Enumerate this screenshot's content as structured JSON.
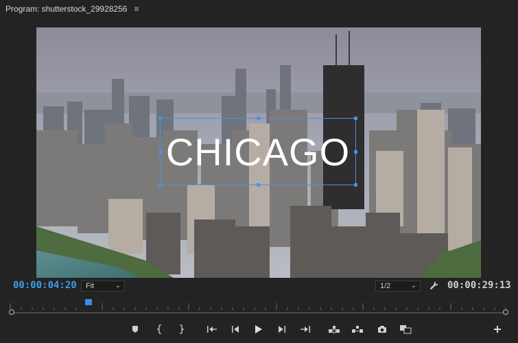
{
  "header": {
    "title": "Program: shutterstock_29928256",
    "menu_glyph": "≡"
  },
  "viewer": {
    "title_text": "CHICAGO"
  },
  "timecode": {
    "current": "00:00:04:20",
    "duration": "00:00:29:13"
  },
  "zoom_select": {
    "value": "Fit"
  },
  "resolution_select": {
    "value": "1/2"
  },
  "colors": {
    "accent": "#3b9cf0",
    "selection": "#4a90e2",
    "panel_bg": "#232323"
  },
  "transport": {
    "icons": [
      "add-marker-icon",
      "mark-in-icon",
      "mark-out-icon",
      "go-to-in-icon",
      "step-back-icon",
      "play-icon",
      "step-forward-icon",
      "go-to-out-icon",
      "lift-icon",
      "extract-icon",
      "export-frame-icon",
      "comparison-view-icon",
      "button-editor-icon"
    ]
  }
}
